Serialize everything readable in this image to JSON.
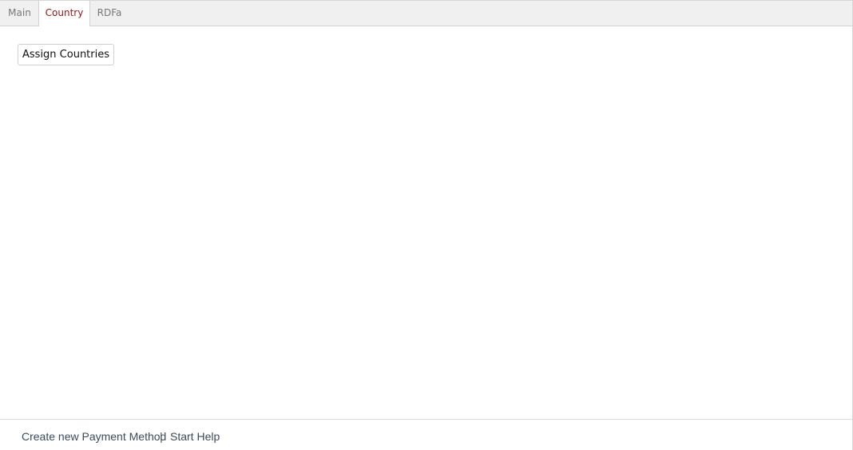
{
  "tabs": {
    "main": "Main",
    "country": "Country",
    "rdfa": "RDFa",
    "active": "Country"
  },
  "content": {
    "assign_button": "Assign Countries"
  },
  "footer": {
    "create_link": "Create new Payment Method",
    "separator": "|",
    "help_link": "Start Help"
  },
  "colors": {
    "active_tab_text": "#8b1a1a",
    "tab_text": "#777777",
    "tabbar_bg": "#f0f0f0",
    "footer_link": "#3a4a5a"
  }
}
